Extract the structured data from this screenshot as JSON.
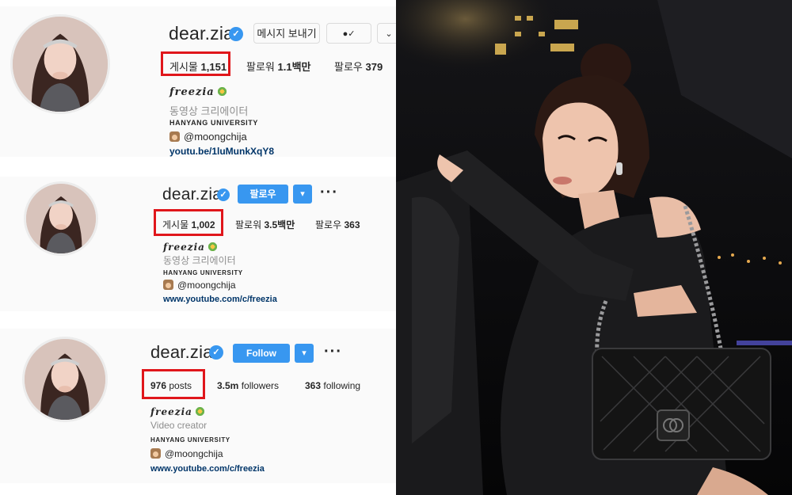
{
  "profiles": [
    {
      "username": "dear.zia",
      "message_button": "메시지 보내기",
      "follow_button": "",
      "posts_label": "게시물",
      "posts_value": "1,151",
      "followers_label": "팔로워",
      "followers_value": "1.1백만",
      "following_label": "팔로우",
      "following_value": "379",
      "bio_name": "freezia",
      "category": "동영상 크리에이터",
      "university": "HANYANG UNIVERSITY",
      "handle": "@moongchija",
      "link": "youtu.be/1luMunkXqY8"
    },
    {
      "username": "dear.zia",
      "follow_button": "팔로우",
      "posts_label": "게시물",
      "posts_value": "1,002",
      "followers_label": "팔로워",
      "followers_value": "3.5백만",
      "following_label": "팔로우",
      "following_value": "363",
      "bio_name": "freezia",
      "category": "동영상 크리에이터",
      "university": "HANYANG UNIVERSITY",
      "handle": "@moongchija",
      "link": "www.youtube.com/c/freezia"
    },
    {
      "username": "dear.zia",
      "follow_button": "Follow",
      "posts_value": "976",
      "posts_label": "posts",
      "followers_value": "3.5m",
      "followers_label": "followers",
      "following_value": "363",
      "following_label": "following",
      "bio_name": "freezia",
      "category": "Video creator",
      "university": "HANYANG UNIVERSITY",
      "handle": "@moongchija",
      "link": "www.youtube.com/c/freezia"
    }
  ],
  "icons": {
    "verified": "verified-badge-icon",
    "following_state": "person-check-icon",
    "dropdown": "chevron-down-icon",
    "more": "more-dots-icon",
    "bio_emoji": "flower-icon",
    "handle_emoji": "face-icon"
  },
  "colors": {
    "highlight": "#e0161b",
    "accent": "#3897f0",
    "link": "#003569"
  }
}
